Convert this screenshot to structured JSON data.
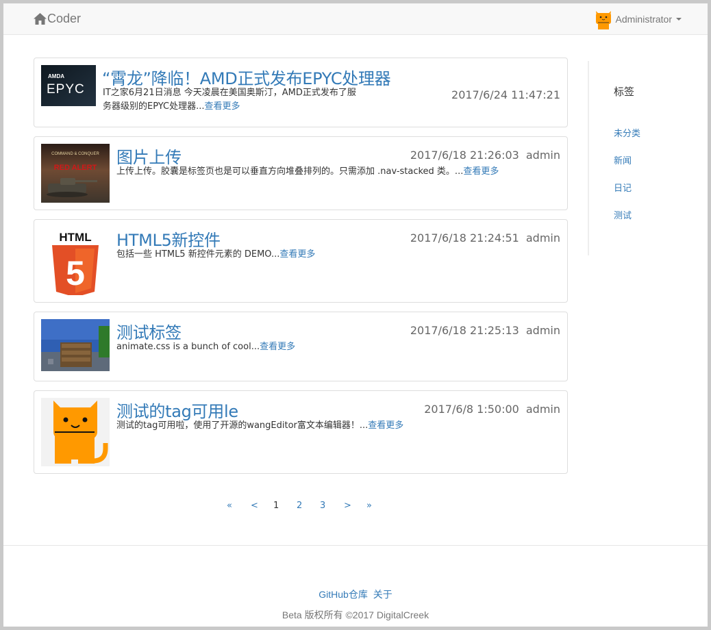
{
  "navbar": {
    "brand": "Coder",
    "user_name": "Administrator"
  },
  "posts": [
    {
      "title": "“霄龙”降临！AMD正式发布EPYC处理器",
      "date": "2017/6/24 11:47:21",
      "author": "",
      "desc_line1": "IT之家6月21日消息 今天凌晨在美国奥斯汀，AMD正式发布了服",
      "desc_line2": "务器级别的EPYC处理器...",
      "more": "查看更多",
      "thumb_text_top": "AMDA",
      "thumb_text_main": "EPYC"
    },
    {
      "title": "图片上传",
      "date": "2017/6/18 21:26:03",
      "author": "admin",
      "desc": "上传上传。胶囊是标签页也是可以垂直方向堆叠排列的。只需添加 .nav-stacked 类。...",
      "more": "查看更多",
      "thumb_text_top": "COMMAND & CONQUER",
      "thumb_text_main": "RED ALERT"
    },
    {
      "title": "HTML5新控件",
      "date": "2017/6/18 21:24:51",
      "author": "admin",
      "desc": "包括一些 HTML5 新控件元素的 DEMO...",
      "more": "查看更多",
      "thumb_text_top": "HTML",
      "thumb_text_main": "5"
    },
    {
      "title": "测试标签",
      "date": "2017/6/18 21:25:13",
      "author": "admin",
      "desc": "animate.css is a bunch of cool...",
      "more": "查看更多"
    },
    {
      "title": "测试的tag可用le",
      "date": "2017/6/8 1:50:00",
      "author": "admin",
      "desc": "测试的tag可用啦，使用了开源的wangEditor富文本编辑器！...",
      "more": "查看更多"
    }
  ],
  "sidebar": {
    "title": "标签",
    "tags": [
      "未分类",
      "新闻",
      "日记",
      "测试"
    ]
  },
  "pagination": {
    "first": "«",
    "prev": "<",
    "pages": [
      "1",
      "2",
      "3"
    ],
    "current": "1",
    "next": ">",
    "last": "»"
  },
  "footer": {
    "link_github": "GitHub仓库",
    "link_about": "关于",
    "copyright": "Beta 版权所有 ©2017 DigitalCreek"
  },
  "colors": {
    "link": "#337ab7",
    "navbar_bg": "#f8f8f8",
    "cat_orange": "#ff9900",
    "html5_orange": "#e34f26"
  }
}
